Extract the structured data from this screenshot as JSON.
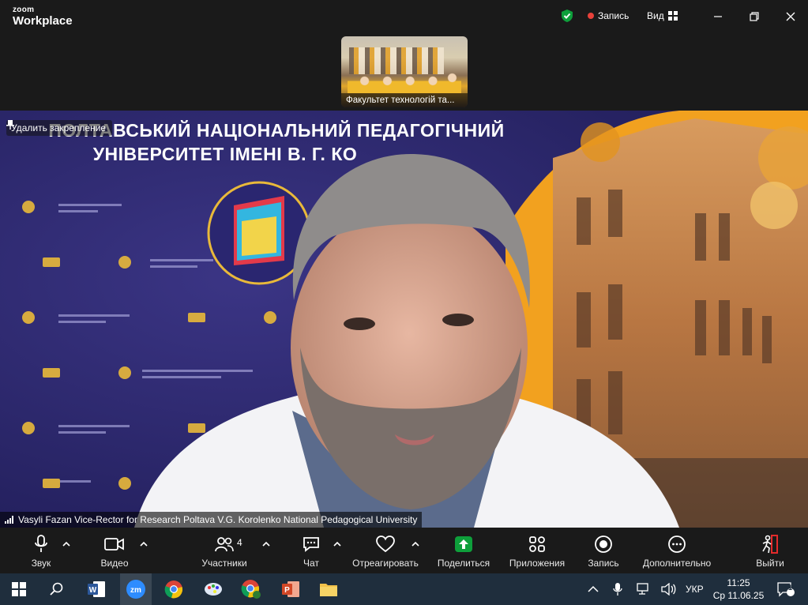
{
  "app": {
    "brand_small": "zoom",
    "brand_large": "Workplace"
  },
  "titlebar": {
    "record_label": "Запись",
    "view_label": "Вид"
  },
  "thumbnail": {
    "label": "Факультет технологій та..."
  },
  "video": {
    "unpin_label": "Удалить закрепление",
    "speaker_name": "Vasyli Fazan Vice-Rector for Research Poltava V.G. Korolenko National Pedagogical University",
    "banner_line1": "ПОЛТАВСЬКИЙ НАЦІОНАЛЬНИЙ ПЕДАГОГІЧНИЙ",
    "banner_line2": "УНІВЕРСИТЕТ ІМЕНІ В. Г. КО"
  },
  "toolbar": {
    "audio": "Звук",
    "video": "Видео",
    "participants": "Участники",
    "participants_count": "4",
    "chat": "Чат",
    "react": "Отреагировать",
    "share": "Поделиться",
    "apps": "Приложения",
    "record": "Запись",
    "more": "Дополнительно",
    "leave": "Выйти"
  },
  "taskbar": {
    "language": "УКР",
    "time": "11:25",
    "date": "Ср 11.06.25",
    "notifications": "1"
  },
  "colors": {
    "accent_green": "#0e9f3b",
    "record_red": "#e8413a",
    "leave_red": "#e22b2b",
    "background_dark": "#1a1a1a",
    "taskbar": "#1f2e3d"
  }
}
